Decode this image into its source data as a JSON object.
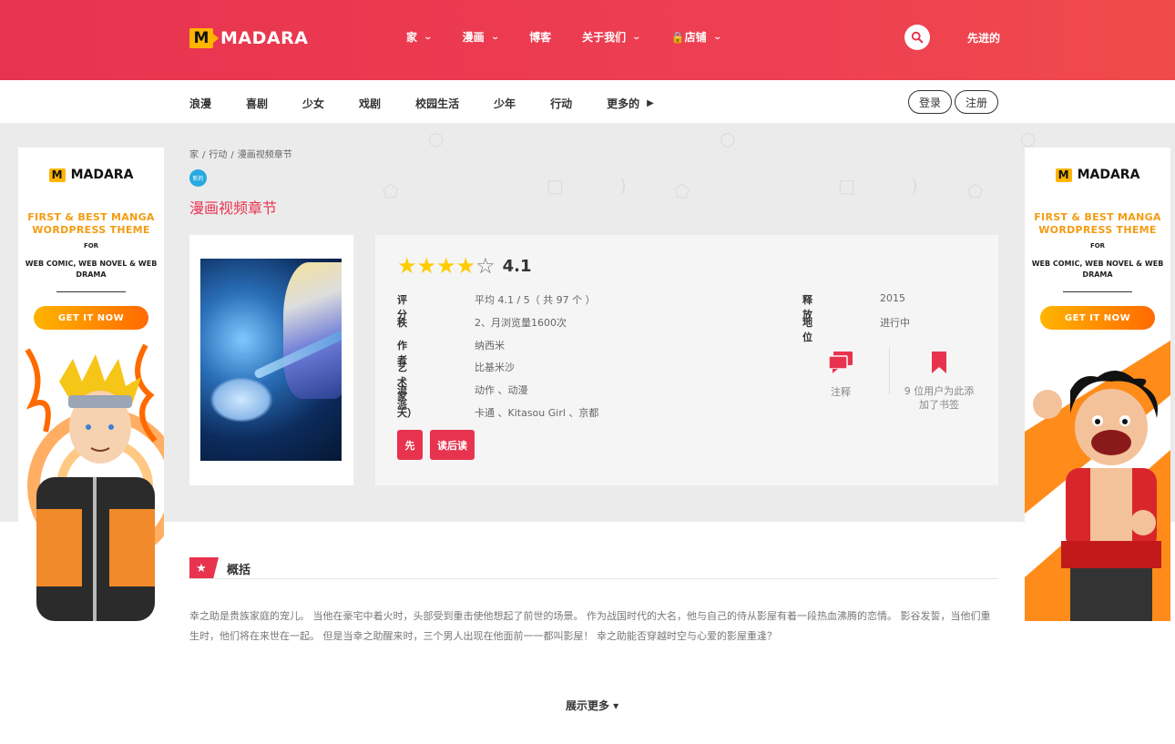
{
  "header": {
    "logo_text": "MADARA",
    "logo_mark": "M",
    "nav": [
      {
        "label": "家",
        "has_dropdown": true
      },
      {
        "label": "漫画",
        "has_dropdown": true
      },
      {
        "label": "博客",
        "has_dropdown": false
      },
      {
        "label": "关于我们",
        "has_dropdown": true
      },
      {
        "label": "🔒店铺",
        "has_dropdown": true
      }
    ],
    "search_icon": "search-icon",
    "advanced_label": "先进的"
  },
  "genre_bar": {
    "genres": [
      "浪漫",
      "喜剧",
      "少女",
      "戏剧",
      "校园生活",
      "少年",
      "行动"
    ],
    "more_label": "更多的",
    "login_label": "登录",
    "register_label": "注册"
  },
  "breadcrumb": [
    "家",
    "/",
    "行动",
    "/",
    "漫画视频章节"
  ],
  "badge": "新的",
  "manga": {
    "title": "漫画视频章节",
    "rating_value": 4.1,
    "rating_display": "4.1",
    "stars_filled": 4,
    "stars_total": 5,
    "details": [
      {
        "key": "评分",
        "value": "平均 4.1 / 5（ 共 97 个 ）"
      },
      {
        "key": "秩",
        "value": "2、月浏览量1600次"
      },
      {
        "key": "作者",
        "value": "纳西米"
      },
      {
        "key": "艺术家",
        "value": "比基米沙"
      },
      {
        "key": "流派",
        "value": "动作 、动漫"
      },
      {
        "key": "天）",
        "value": "卡通 、Kitasou Girl 、京都"
      }
    ],
    "details_right": [
      {
        "key": "释放",
        "value": "2015"
      },
      {
        "key": "地位",
        "value": "进行中"
      }
    ],
    "buttons": {
      "first": "先",
      "continue": "读后读"
    },
    "comments_label": "注释",
    "bookmark_label": "9 位用户为此添加了书签"
  },
  "ads": {
    "logo_text": "MADARA",
    "logo_mark": "M",
    "headline": "FIRST & BEST MANGA WORDPRESS THEME",
    "for": "FOR",
    "sub": "WEB COMIC, WEB NOVEL & WEB DRAMA",
    "cta": "GET IT NOW"
  },
  "summary": {
    "title": "概括",
    "text": "幸之助是贵族家庭的宠儿。 当他在豪宅中着火时，头部受到重击使他想起了前世的场景。 作为战国时代的大名，他与自己的侍从影屋有着一段热血沸腾的恋情。 影谷发誓，当他们重生时，他们将在来世在一起。 但是当幸之助醒来时，三个男人出现在他面前一一都叫影屋！ 幸之助能否穿越时空与心爱的影屋重逢？",
    "show_more": "展示更多 ▾"
  },
  "colors": {
    "accent": "#e8334f",
    "star": "#ffcc00",
    "badge": "#27a9e1",
    "cta": "#ffb400"
  }
}
